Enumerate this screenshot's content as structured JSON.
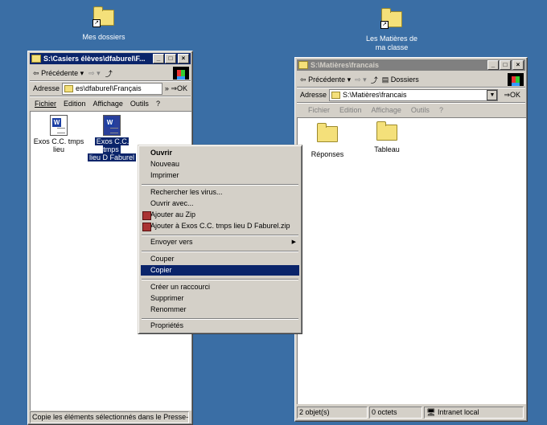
{
  "desktop": {
    "icons": [
      {
        "label": "Mes dossiers"
      },
      {
        "label_line1": "Les Matières de",
        "label_line2": "ma classe"
      }
    ]
  },
  "left_window": {
    "title": "S:\\Casiers élèves\\dfaburel\\F...",
    "toolbar": {
      "back": "Précédente"
    },
    "address": {
      "label": "Adresse",
      "value": "es\\dfaburel\\Français",
      "go": "OK"
    },
    "menu": [
      "Fichier",
      "Edition",
      "Affichage",
      "Outils",
      "?"
    ],
    "files": [
      {
        "line1": "Exos C.C. tmps",
        "line2": "lieu"
      },
      {
        "line1": "Exos C.C. tmps",
        "line2": "lieu D Faburel"
      }
    ],
    "status": "Copie les éléments sélectionnés dans le Presse-p"
  },
  "right_window": {
    "title": "S:\\Matières\\francais",
    "toolbar": {
      "back": "Précédente",
      "folders": "Dossiers"
    },
    "address": {
      "label": "Adresse",
      "value": "S:\\Matières\\francais",
      "go": "OK"
    },
    "menu": [
      "Fichier",
      "Edition",
      "Affichage",
      "Outils",
      "?"
    ],
    "folders": [
      "Réponses",
      "Tableau"
    ],
    "status": {
      "objects": "2 objet(s)",
      "size": "0 octets",
      "zone": "Intranet local"
    }
  },
  "context_menu": {
    "items": [
      "Ouvrir",
      "Nouveau",
      "Imprimer",
      "Rechercher les virus...",
      "Ouvrir avec...",
      "Ajouter au Zip",
      "Ajouter à Exos C.C. tmps lieu D Faburel.zip",
      "Envoyer vers",
      "Couper",
      "Copier",
      "Créer un raccourci",
      "Supprimer",
      "Renommer",
      "Propriétés"
    ]
  },
  "colors": {
    "desktop": "#3a6ea5",
    "title_active": "#0a246a",
    "title_inactive": "#808080",
    "menu_highlight": "#0a246a"
  }
}
